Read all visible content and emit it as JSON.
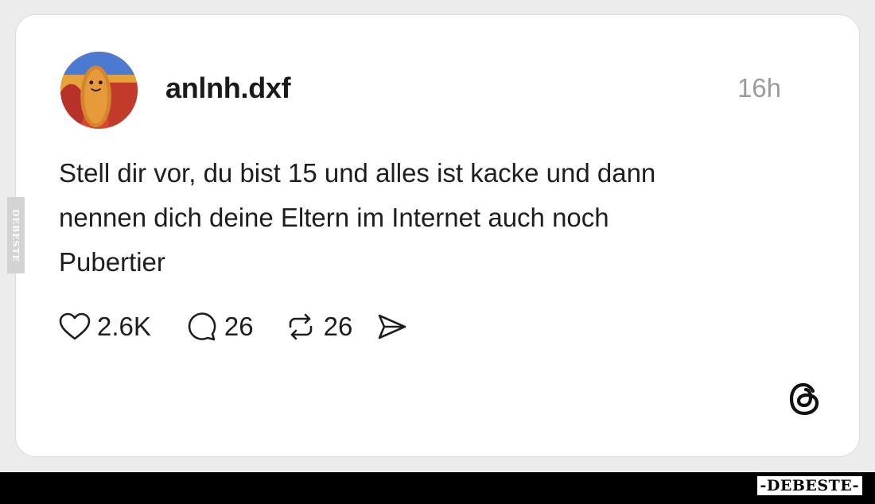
{
  "post": {
    "username": "anlnh.dxf",
    "time": "16h",
    "text_lines": [
      "Stell dir vor, du bist 15 und alles ist kacke und dann",
      "nennen dich deine Eltern im Internet auch noch",
      "Pubertier"
    ],
    "likes": "2.6K",
    "comments": "26",
    "reposts": "26"
  },
  "icons": {
    "avatar": "hotdog-avatar",
    "like": "heart-icon",
    "comment": "comment-bubble-icon",
    "repost": "repost-icon",
    "share": "send-icon",
    "app_logo": "threads-logo-icon"
  },
  "watermark": {
    "side": "DEBESTE",
    "footer": "-DEBESTE-"
  },
  "colors": {
    "card_bg": "#ffffff",
    "page_bg": "#ececec",
    "text": "#1e1e1e",
    "muted": "#9b9b9b",
    "footer_bar": "#000000"
  }
}
